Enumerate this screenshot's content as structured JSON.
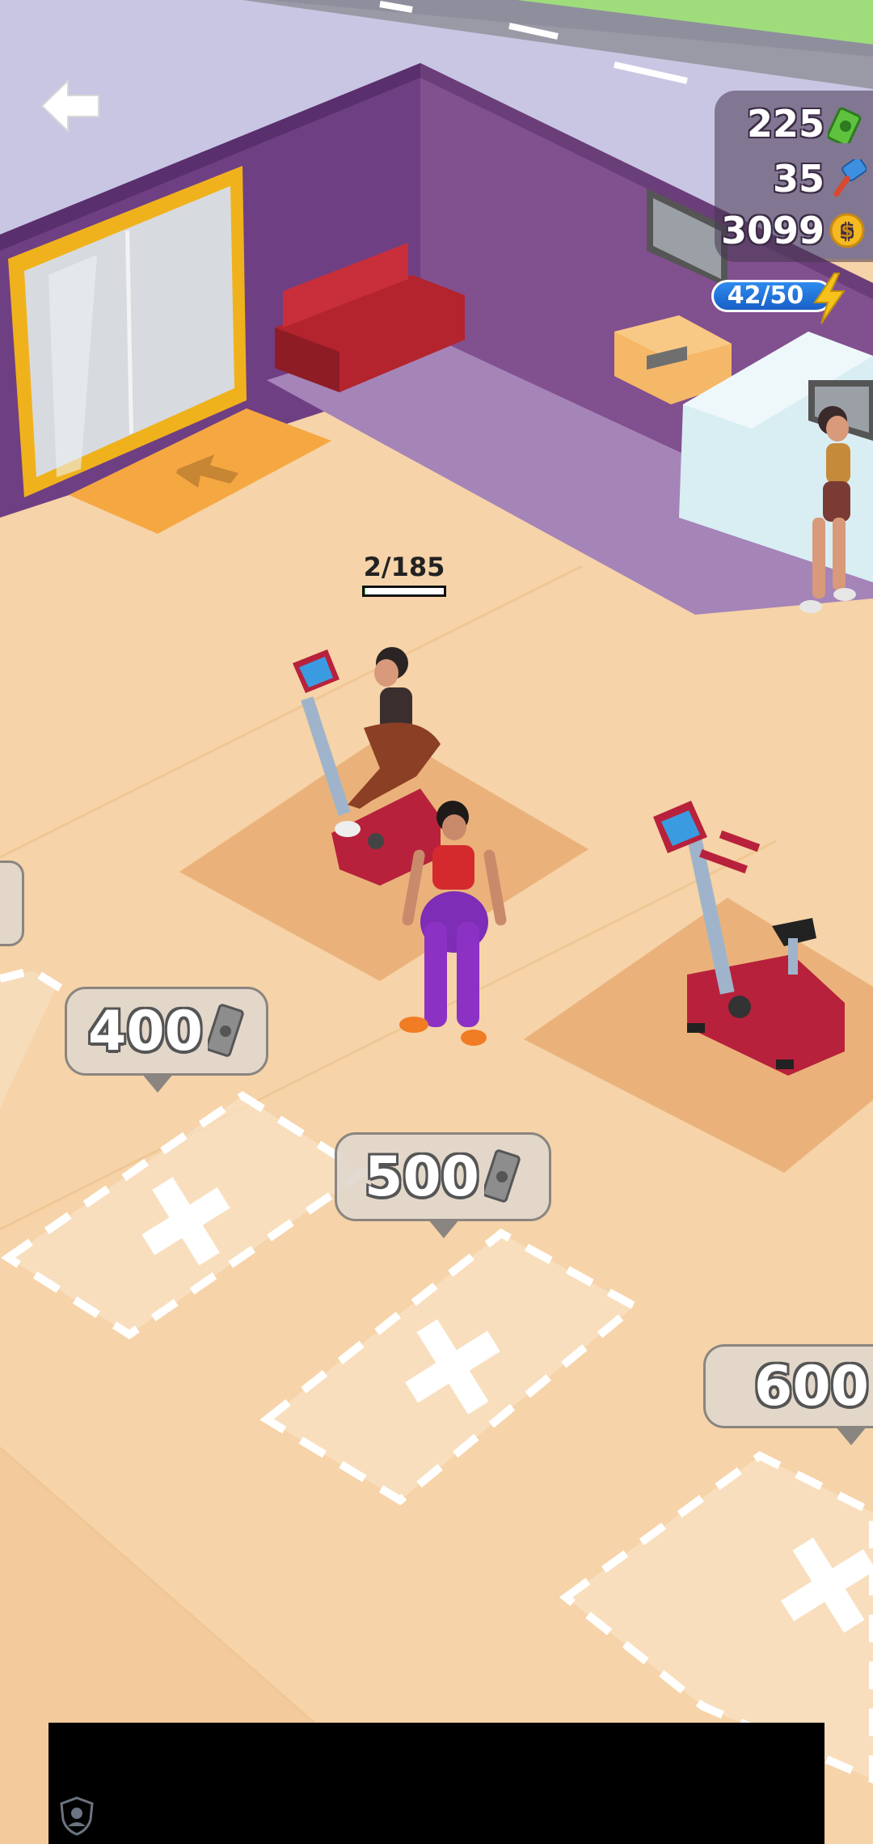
{
  "hud": {
    "cash": "225",
    "hammers": "35",
    "coins": "3099",
    "energy": "42/50"
  },
  "workout_progress": {
    "label": "2/185",
    "fraction": 0.0108
  },
  "purchase_spots": [
    {
      "price": "400"
    },
    {
      "price": "500"
    },
    {
      "price": "600"
    }
  ],
  "icons": {
    "back": "back-arrow-icon",
    "cash": "cash-icon",
    "hammer": "hammer-icon",
    "coin": "coin-icon",
    "energy": "lightning-icon",
    "bill": "bill-icon",
    "ad_shield": "shield-icon"
  },
  "colors": {
    "floor": "#f6d3a8",
    "wall": "#7d4a8c",
    "door_frame": "#f0b21c",
    "bike": "#c1263e",
    "energy_pill": "#2373d9"
  }
}
